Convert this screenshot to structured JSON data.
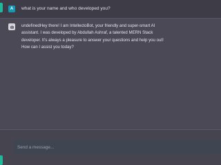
{
  "conversation": {
    "user_message": {
      "avatar_letter": "A",
      "text": "what is your name and who developed you?"
    },
    "bot_message": {
      "avatar_icon": "robot-icon",
      "lines": [
        "undefinedHey there! I am IntellectoBot, your friendly and super-smart AI",
        "assistant. I was developed by Abdullah Ashraf, a talented MERN Stack",
        "developer. It's always a pleasure to answer your questions and help you out!",
        "How can I assist you today?"
      ]
    }
  },
  "composer": {
    "placeholder": "Send a message..."
  },
  "colors": {
    "accent": "#1fb89a",
    "user_avatar": "#1697b3",
    "chat_background": "#4a4955",
    "input_background": "#3f4651"
  }
}
